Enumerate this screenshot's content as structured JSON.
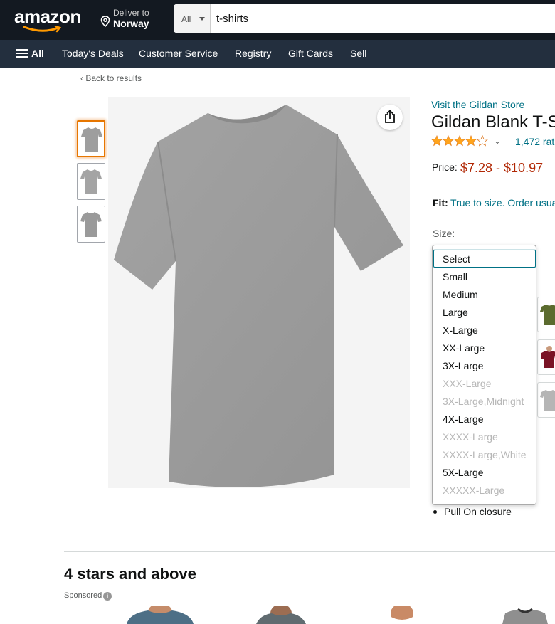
{
  "header": {
    "logo": "amazon",
    "deliver_label": "Deliver to",
    "deliver_location": "Norway",
    "search_category": "All",
    "search_value": "t-shirts"
  },
  "subnav": {
    "all_label": "All",
    "items": [
      "Today's Deals",
      "Customer Service",
      "Registry",
      "Gift Cards",
      "Sell"
    ]
  },
  "breadcrumb": {
    "back_label": "‹ Back to results"
  },
  "product": {
    "store_link": "Visit the Gildan Store",
    "title": "Gildan Blank T-S",
    "rating_stars": 4.5,
    "ratings_count": "1,472 rat",
    "price_label": "Price:",
    "price_range": "$7.28 - $10.97",
    "fit_label": "Fit:",
    "fit_text": "True to size. Order usua",
    "size_label": "Size:",
    "bullet": "Pull On closure",
    "image_color": "#9e9e9e"
  },
  "size_dropdown": {
    "selected": "Select",
    "options": [
      {
        "label": "Select",
        "enabled": true
      },
      {
        "label": "Small",
        "enabled": true
      },
      {
        "label": "Medium",
        "enabled": true
      },
      {
        "label": "Large",
        "enabled": true
      },
      {
        "label": "X-Large",
        "enabled": true
      },
      {
        "label": "XX-Large",
        "enabled": true
      },
      {
        "label": "3X-Large",
        "enabled": true
      },
      {
        "label": "XXX-Large",
        "enabled": false
      },
      {
        "label": "3X-Large,Midnight",
        "enabled": false
      },
      {
        "label": "4X-Large",
        "enabled": true
      },
      {
        "label": "XXXX-Large",
        "enabled": false
      },
      {
        "label": "XXXX-Large,White",
        "enabled": false
      },
      {
        "label": "5X-Large",
        "enabled": true
      },
      {
        "label": "XXXXX-Large",
        "enabled": false
      }
    ]
  },
  "recommendations": {
    "title": "4 stars and above",
    "sponsored_label": "Sponsored",
    "info_glyph": "i"
  },
  "colors": {
    "nav_dark": "#131921",
    "nav_sub": "#232f3e",
    "link": "#007185",
    "price": "#b12704",
    "star": "#ffa41c",
    "selected_thumb": "#e77600"
  }
}
